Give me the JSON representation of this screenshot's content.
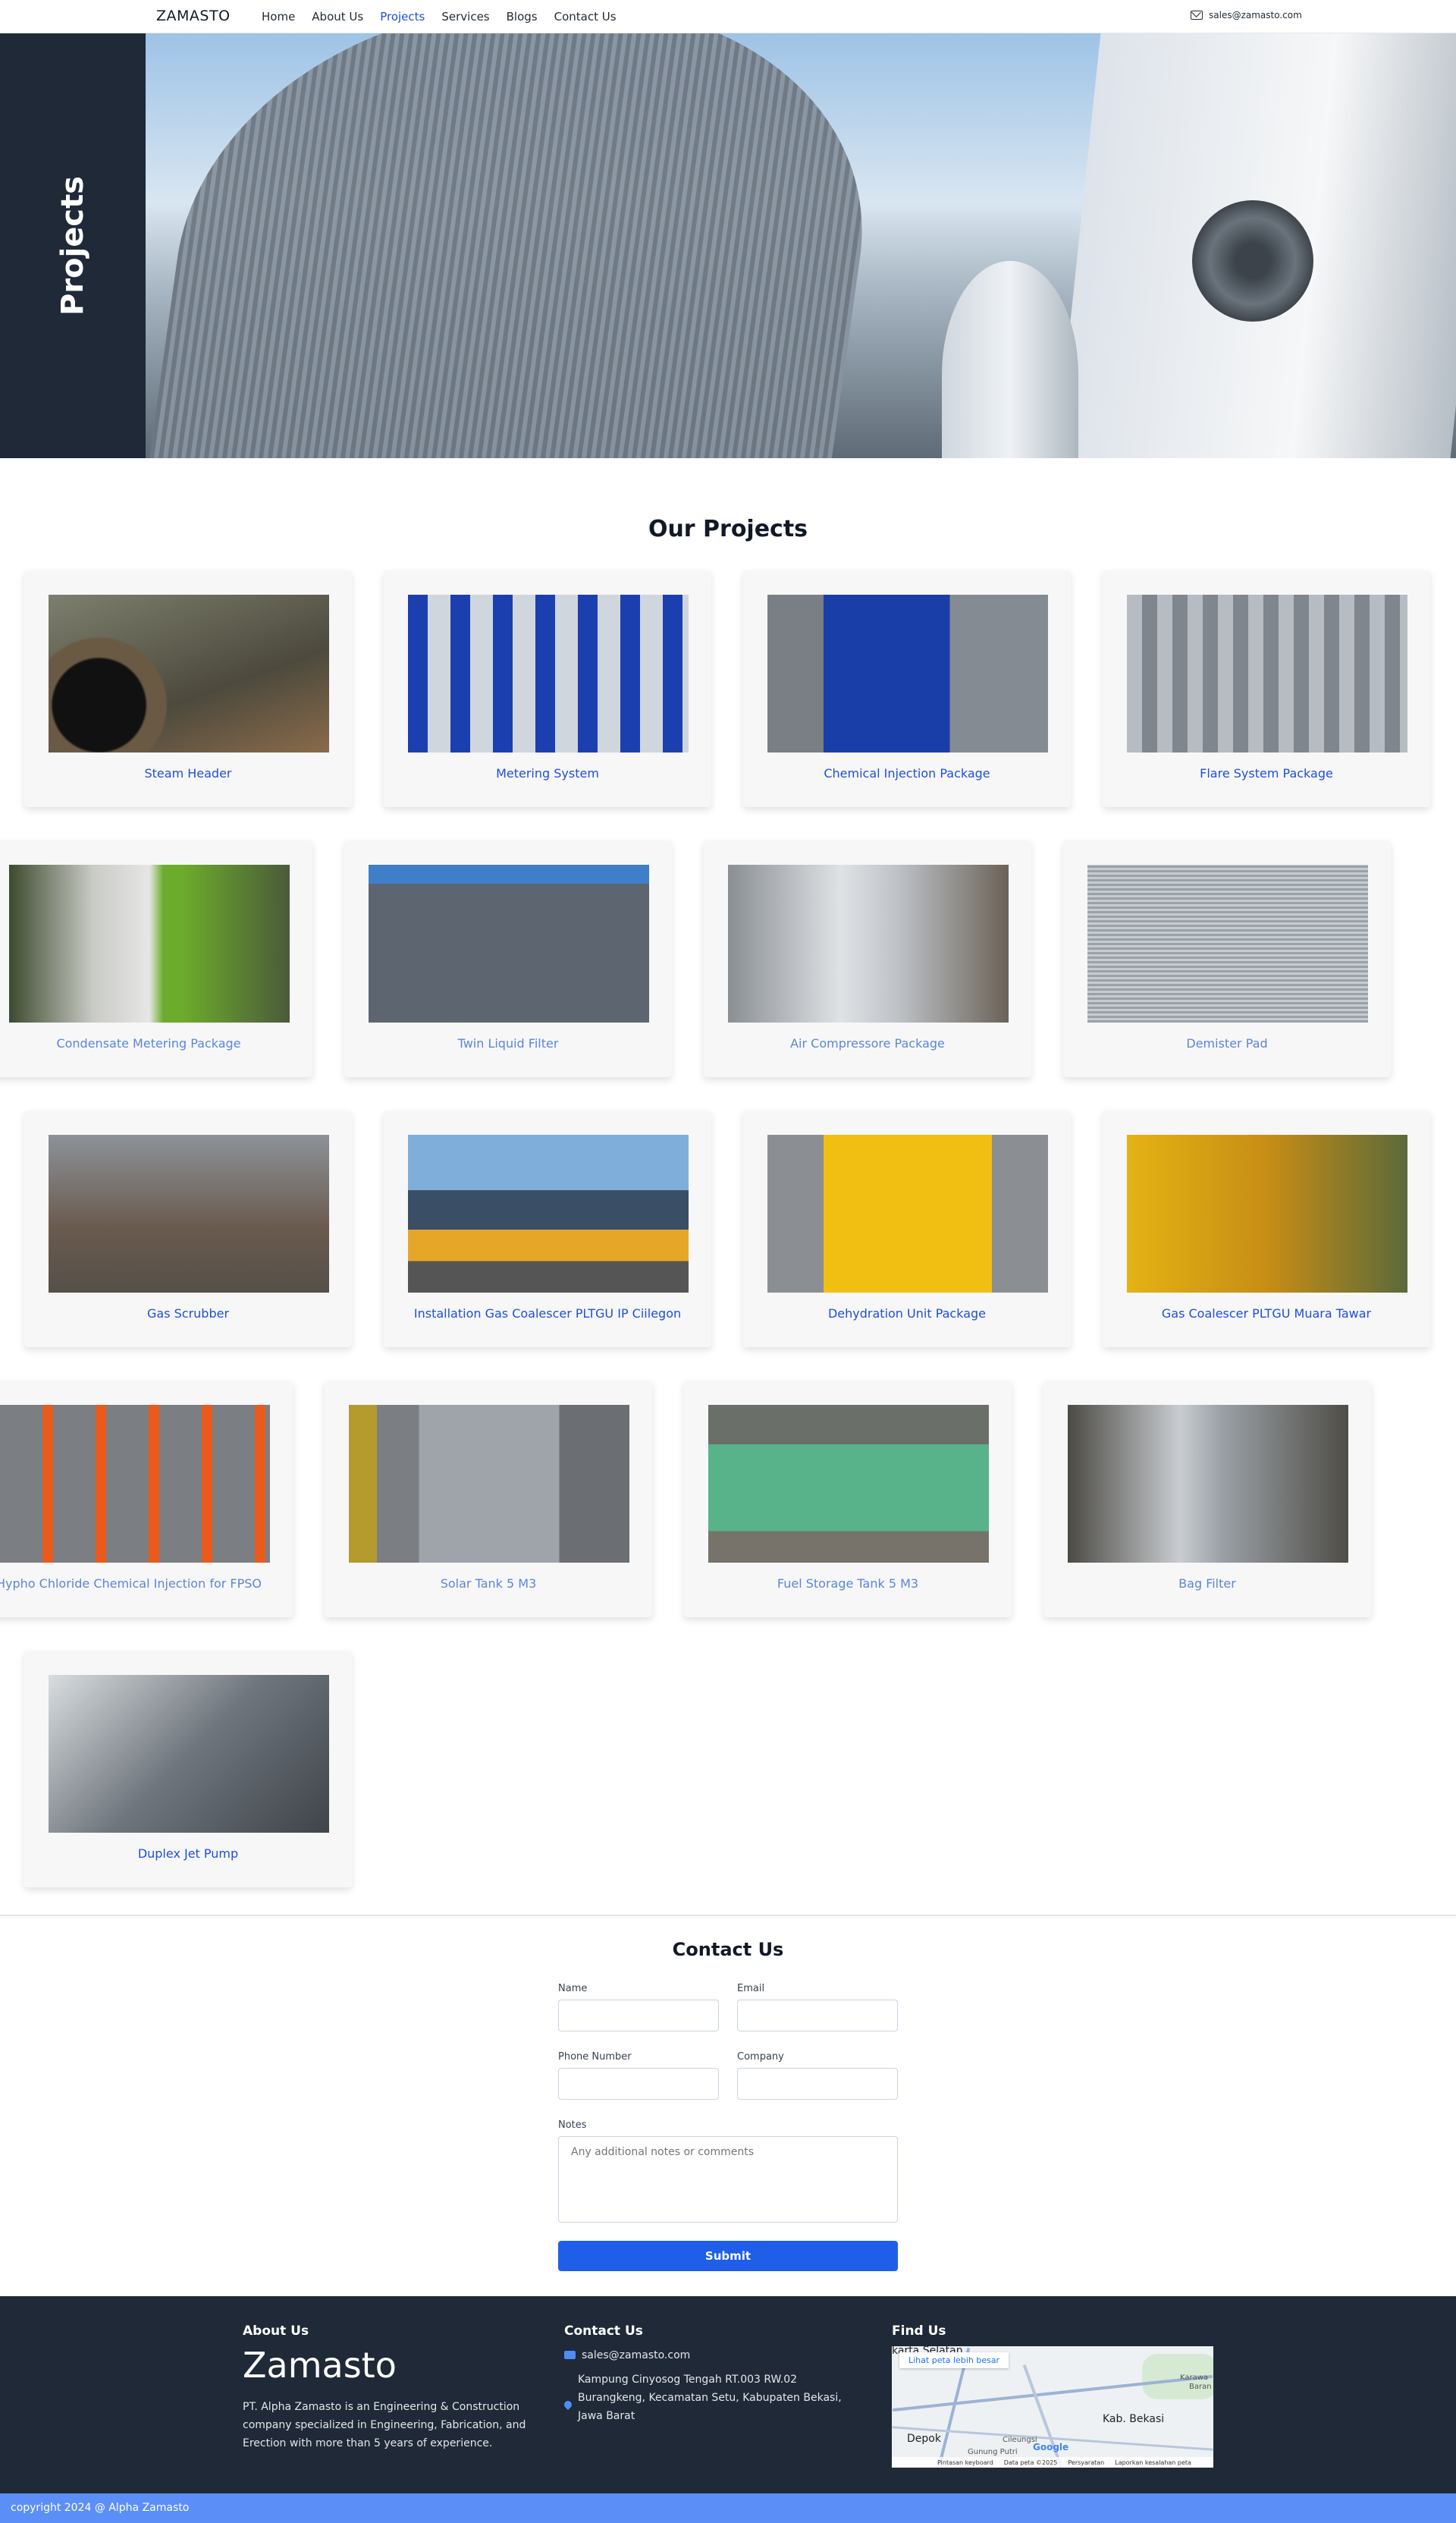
{
  "nav": {
    "brand": "ZAMASTO",
    "links": [
      {
        "label": "Home"
      },
      {
        "label": "About Us"
      },
      {
        "label": "Projects"
      },
      {
        "label": "Services"
      },
      {
        "label": "Blogs"
      },
      {
        "label": "Contact Us"
      }
    ],
    "active": "Projects",
    "email": "sales@zamasto.com"
  },
  "hero": {
    "title": "Projects"
  },
  "projects": {
    "title": "Our Projects",
    "items": [
      {
        "label": "Steam Header"
      },
      {
        "label": "Metering System"
      },
      {
        "label": "Chemical Injection Package"
      },
      {
        "label": "Flare System Package"
      },
      {
        "label": "Condensate Metering Package"
      },
      {
        "label": "Twin Liquid Filter"
      },
      {
        "label": "Air Compressore Package"
      },
      {
        "label": "Demister Pad"
      },
      {
        "label": "Gas Scrubber"
      },
      {
        "label": "Installation Gas Coalescer PLTGU IP Ciilegon"
      },
      {
        "label": "Dehydration Unit Package"
      },
      {
        "label": "Gas Coalescer PLTGU Muara Tawar"
      },
      {
        "label": "Hypho Chloride Chemical Injection for FPSO"
      },
      {
        "label": "Solar Tank 5 M3"
      },
      {
        "label": "Fuel Storage Tank 5 M3"
      },
      {
        "label": "Bag Filter"
      },
      {
        "label": "Duplex Jet Pump"
      }
    ]
  },
  "contact": {
    "title": "Contact Us",
    "name_label": "Name",
    "email_label": "Email",
    "phone_label": "Phone Number",
    "company_label": "Company",
    "notes_label": "Notes",
    "notes_placeholder": "Any additional notes or comments",
    "submit_label": "Submit"
  },
  "footer": {
    "about_heading": "About Us",
    "logo": "Zamasto",
    "about_text": "PT. Alpha Zamasto is an Engineering & Construction company specialized in Engineering, Fabrication, and Erection with more than 5 years of experience.",
    "contact_heading": "Contact Us",
    "email": "sales@zamasto.com",
    "address": "Kampung Cinyosog Tengah RT.003 RW.02 Burangkeng, Kecamatan Setu, Kabupaten Bekasi, Jawa Barat",
    "find_heading": "Find Us",
    "map": {
      "link": "Lihat peta lebih besar",
      "places": [
        "karta Selatan",
        "Kab. Bekasi",
        "Depok",
        "Karawa",
        "Baran",
        "Cileungsi",
        "Gunung Putri"
      ],
      "footer_items": [
        "Pintasan keyboard",
        "Data peta ©2025",
        "Persyaratan",
        "Laporkan kesalahan peta"
      ],
      "google_logo": "Google"
    },
    "copyright": "copyright 2024 @ Alpha Zamasto"
  },
  "colors": {
    "accent": "#1e4fd8",
    "dark": "#1f2937",
    "button": "#1f5ee8",
    "copyright_bar": "#5b8ff7"
  }
}
